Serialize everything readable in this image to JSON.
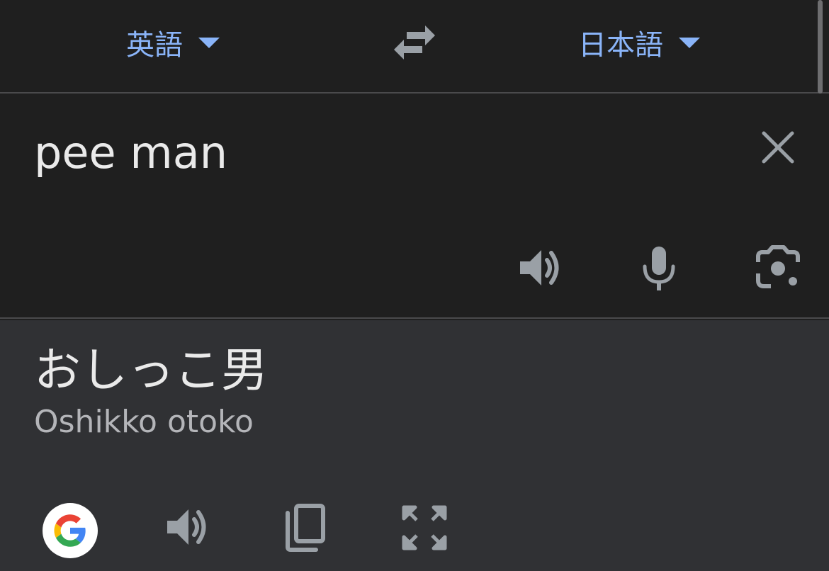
{
  "header": {
    "source_language": "英語",
    "target_language": "日本語"
  },
  "input": {
    "text": "pee man"
  },
  "output": {
    "translation": "おしっこ男",
    "romanization": "Oshikko otoko"
  },
  "colors": {
    "accent": "#8ab4f8",
    "icon": "#9aa0a6",
    "background": "#1f1f1f",
    "output_background": "#303134"
  },
  "icons": {
    "swap": "swap-arrows-icon",
    "clear": "close-icon",
    "speak_source": "speaker-icon",
    "mic": "microphone-icon",
    "camera": "camera-lens-icon",
    "google": "google-logo-icon",
    "speak_translation": "speaker-icon",
    "copy": "copy-icon",
    "fullscreen": "fullscreen-icon"
  }
}
